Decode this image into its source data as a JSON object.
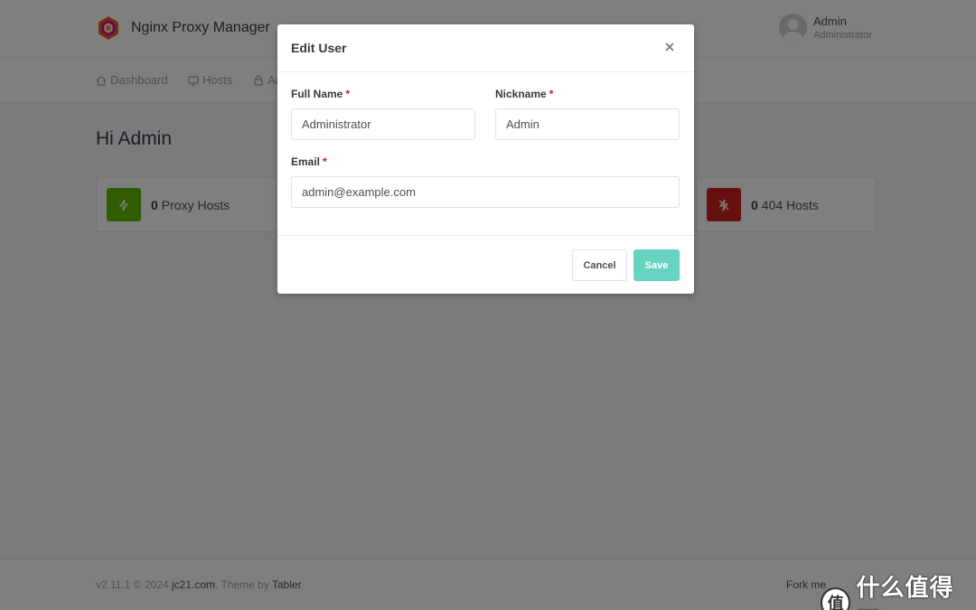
{
  "app": {
    "name": "Nginx Proxy Manager"
  },
  "user": {
    "name": "Admin",
    "role": "Administrator"
  },
  "nav": {
    "items": [
      {
        "label": "Dashboard"
      },
      {
        "label": "Hosts"
      },
      {
        "label": "Ac"
      }
    ]
  },
  "page": {
    "title": "Hi Admin"
  },
  "cards": [
    {
      "count": "0",
      "label": "Proxy Hosts",
      "color": "#5eba00"
    },
    {
      "count": "0",
      "label": "404 Hosts",
      "color": "#cd201f"
    }
  ],
  "footer": {
    "version": "v2.11.1 © 2024 ",
    "link": "jc21.com",
    "theme_text": ". Theme by ",
    "theme_link": "Tabler",
    "right": "Fork me"
  },
  "watermark": {
    "badge": "值",
    "text": "什么值得买"
  },
  "modal": {
    "title": "Edit User",
    "fields": {
      "full_name": {
        "label": "Full Name",
        "value": "Administrator"
      },
      "nickname": {
        "label": "Nickname",
        "value": "Admin"
      },
      "email": {
        "label": "Email",
        "value": "admin@example.com"
      }
    },
    "required_mark": "*",
    "cancel_label": "Cancel",
    "save_label": "Save"
  },
  "colors": {
    "accent": "#67d4c1",
    "overlay": "rgba(0,0,0,0.5)"
  }
}
